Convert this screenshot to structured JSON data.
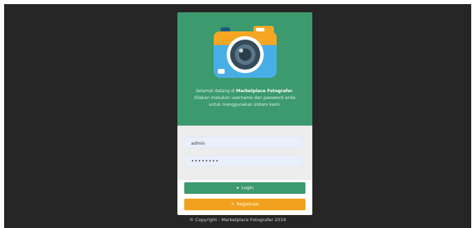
{
  "login": {
    "welcome_prefix": "Selamat datang di ",
    "brand": "Marketplace Fotografer",
    "welcome_suffix": ".",
    "instructions_line2": "Silakan masukan username dan password anda",
    "instructions_line3": "untuk menggunakan sistem kami.",
    "username_value": "admin",
    "password_value": "••••••••",
    "login_label": "Login",
    "register_label": "Registrasi",
    "login_icon": "sign-in-icon",
    "register_icon": "edit-icon"
  },
  "footer": {
    "copyright": "© Copyright - Marketplace Fotografer 2019"
  },
  "colors": {
    "background": "#262626",
    "brand_green": "#3c9a6e",
    "accent_orange": "#f0a11d",
    "input_bg": "#e9effb"
  }
}
